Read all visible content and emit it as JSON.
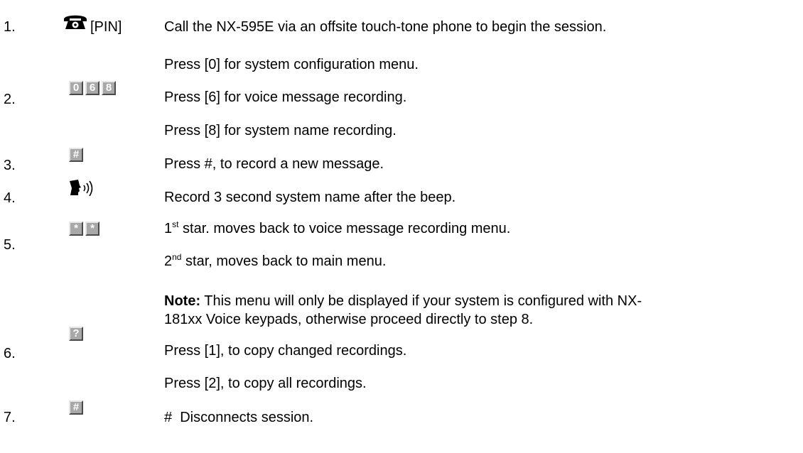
{
  "steps": [
    {
      "number": "1.",
      "keys": [],
      "icon": "telephone-icon",
      "key_label": "[PIN]",
      "lines": [
        "Call the NX-595E via an offsite touch-tone phone to begin the session."
      ]
    },
    {
      "number": "2.",
      "keys": [
        "0",
        "6",
        "8"
      ],
      "lines": [
        "Press [0] for system configuration menu.",
        "Press [6] for voice message recording.",
        "Press [8] for system name recording."
      ]
    },
    {
      "number": "3.",
      "keys": [
        "#"
      ],
      "lines": [
        "Press #, to record a new message."
      ]
    },
    {
      "number": "4.",
      "keys": [],
      "icon": "speaking-head-icon",
      "lines": [
        "Record 3 second system name after the beep."
      ]
    },
    {
      "number": "5.",
      "keys": [
        "*",
        "*"
      ],
      "lines": [
        {
          "prefix": "1",
          "sup": "st",
          "text": " star. moves back to voice message recording menu."
        },
        {
          "prefix": "2",
          "sup": "nd",
          "text": " star, moves back to main menu."
        }
      ]
    },
    {
      "number": "6.",
      "keys": [
        "?"
      ],
      "note_label": "Note:",
      "note_text_line1": " This menu will only be displayed if your system is configured with NX-",
      "note_text_line2": "181xx Voice keypads, otherwise proceed directly to step 8.",
      "lines": [
        "Press [1], to copy changed recordings.",
        "Press [2], to copy all recordings."
      ]
    },
    {
      "number": "7.",
      "keys": [
        "#"
      ],
      "lines": [
        "#  Disconnects session."
      ]
    }
  ]
}
